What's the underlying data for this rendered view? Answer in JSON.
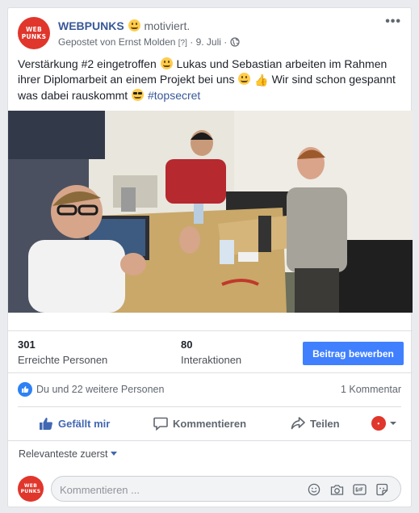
{
  "post": {
    "page_name": "WEBPUNKS",
    "feeling": "motiviert.",
    "posted_by": "Gepostet von Ernst Molden",
    "help_mark": "[?]",
    "date": "9. Juli",
    "sep": "·",
    "more_icon": "•••",
    "avatar_line1": "WEB",
    "avatar_line2": "PUNKS",
    "text_part1": "Verstärkung #2 eingetroffen",
    "text_part2": " Lukas und Sebastian arbeiten im Rahmen ihrer Diplomarbeit an einem Projekt bei uns",
    "text_part3": " Wir sind schon gespannt was dabei rauskommt",
    "hashtag": "#topsecret"
  },
  "insights": {
    "reached_count": "301",
    "reached_label": "Erreichte Personen",
    "interactions_count": "80",
    "interactions_label": "Interaktionen",
    "promote_label": "Beitrag bewerben"
  },
  "reactions": {
    "summary": "Du und 22 weitere Personen",
    "comments_count": "1 Kommentar"
  },
  "actions": {
    "like": "Gefällt mir",
    "comment": "Kommentieren",
    "share": "Teilen"
  },
  "comments": {
    "sort_label": "Relevanteste zuerst",
    "placeholder": "Kommentieren ..."
  },
  "colors": {
    "link_blue": "#385898",
    "action_blue": "#4267b2",
    "button_blue": "#4080ff",
    "brand_red": "#e0362b"
  },
  "icons": [
    "globe-icon",
    "more-icon",
    "like-icon",
    "comment-icon",
    "share-icon",
    "emoji-icon",
    "camera-icon",
    "gif-icon",
    "sticker-icon"
  ]
}
